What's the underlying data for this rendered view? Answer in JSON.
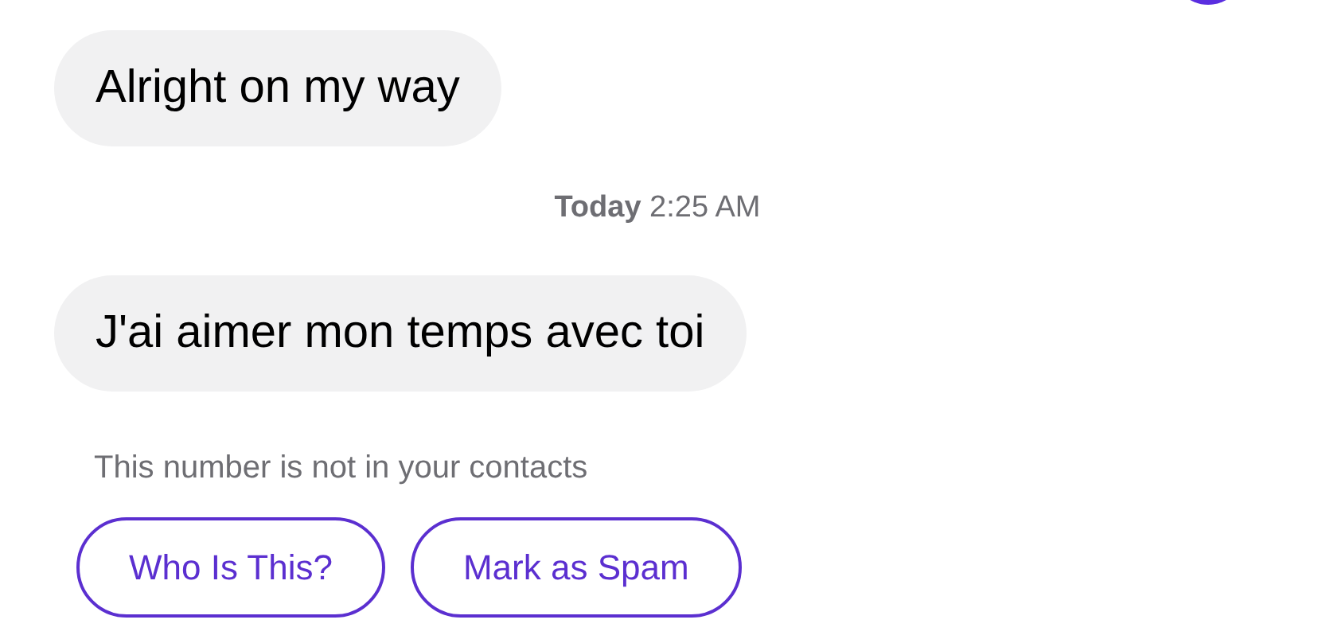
{
  "messages": [
    {
      "kind": "received",
      "text": "Alright on my way"
    },
    {
      "kind": "timestamp",
      "day": "Today",
      "time": "2:25 AM"
    },
    {
      "kind": "received",
      "text": "J'ai aimer mon temps avec toi"
    }
  ],
  "notice": "This number is not in your contacts",
  "actions": [
    "Who Is This?",
    "Mark as Spam"
  ]
}
